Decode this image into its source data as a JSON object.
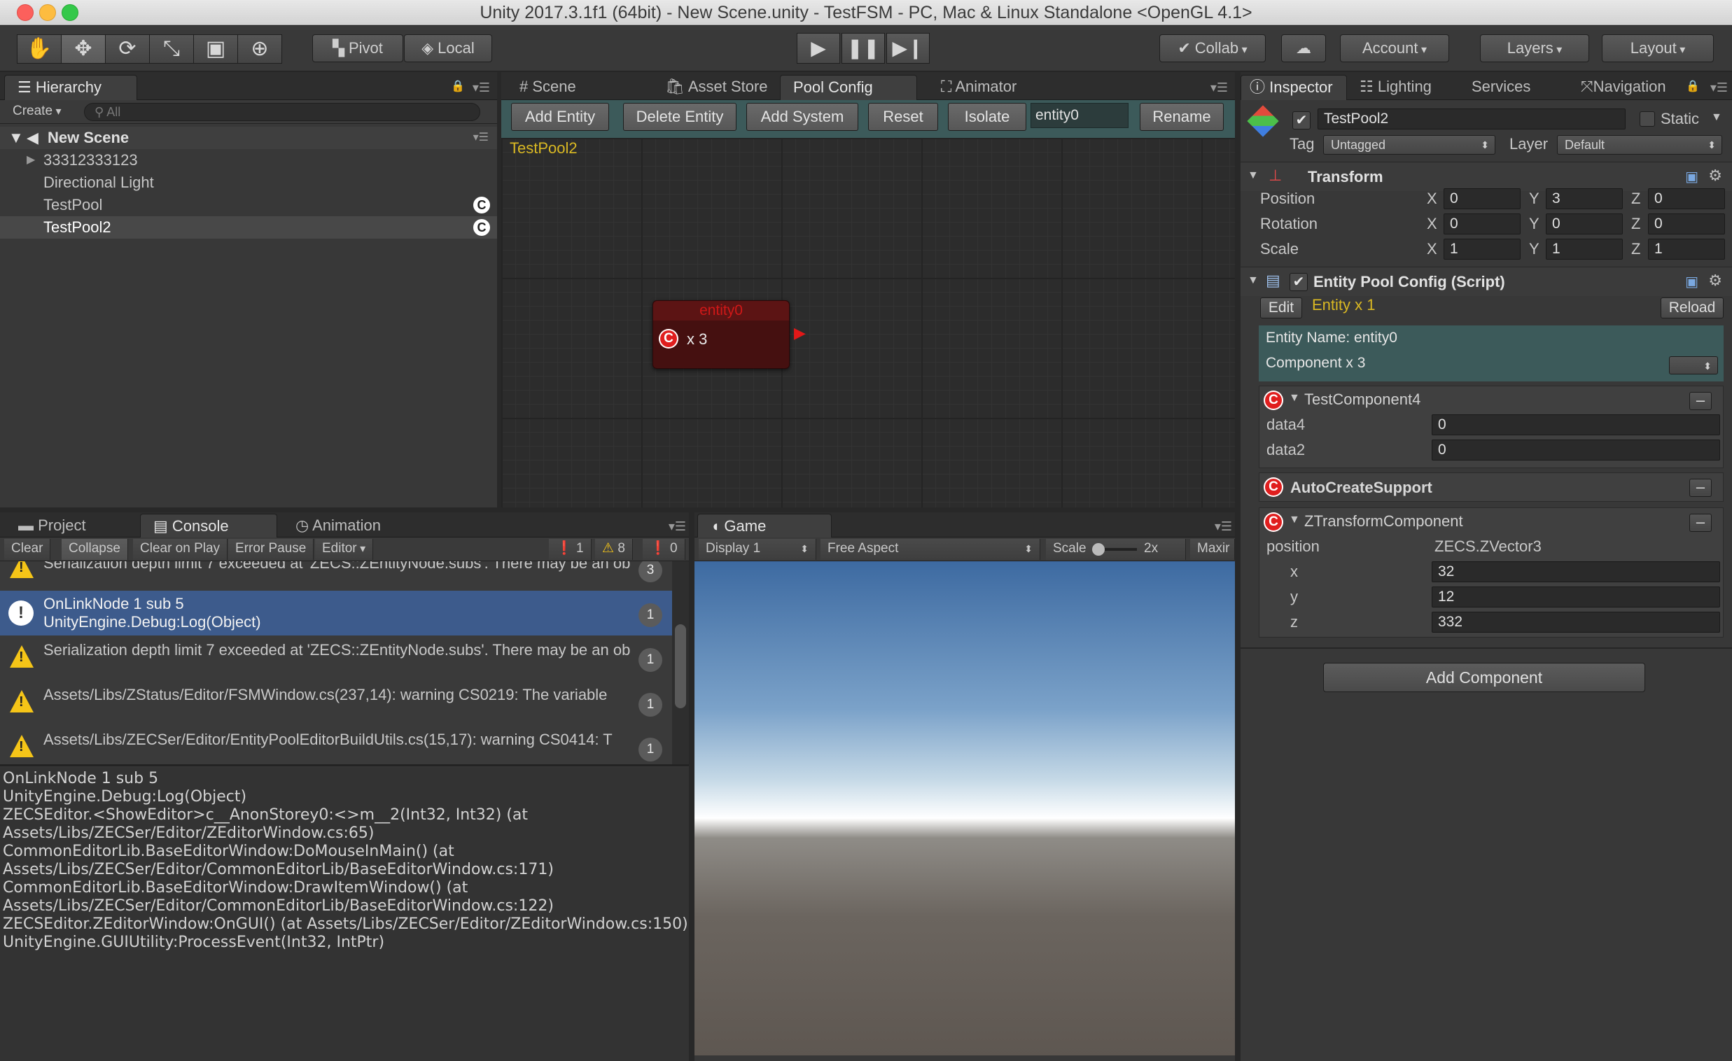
{
  "window": {
    "title": "Unity 2017.3.1f1 (64bit) - New Scene.unity - TestFSM - PC, Mac & Linux Standalone <OpenGL 4.1>"
  },
  "toolbar": {
    "pivot": "Pivot",
    "local": "Local",
    "collab": "Collab",
    "account": "Account",
    "layers": "Layers",
    "layout": "Layout"
  },
  "hierarchy": {
    "tab": "Hierarchy",
    "create": "Create",
    "search_placeholder": "All",
    "scene": "New Scene",
    "items": [
      {
        "label": "33312333123",
        "badge": ""
      },
      {
        "label": "Directional Light",
        "badge": ""
      },
      {
        "label": "TestPool",
        "badge": "C"
      },
      {
        "label": "TestPool2",
        "badge": "C"
      }
    ]
  },
  "center_tabs": {
    "scene": "Scene",
    "asset_store": "Asset Store",
    "pool_config": "Pool Config",
    "animator": "Animator"
  },
  "pool_config": {
    "buttons": {
      "add_entity": "Add Entity",
      "delete_entity": "Delete Entity",
      "add_system": "Add System",
      "reset": "Reset",
      "isolate": "Isolate",
      "rename": "Rename"
    },
    "name_field": "entity0",
    "pool_label": "TestPool2",
    "node": {
      "title": "entity0",
      "badge": "C",
      "count": "x 3"
    }
  },
  "bottom_tabs": {
    "project": "Project",
    "console": "Console",
    "animation": "Animation",
    "game": "Game"
  },
  "console": {
    "toolbar": {
      "clear": "Clear",
      "collapse": "Collapse",
      "clear_on_play": "Clear on Play",
      "error_pause": "Error Pause",
      "editor": "Editor"
    },
    "counts": {
      "info": "1",
      "warn": "8",
      "error": "0"
    },
    "rows": [
      {
        "line1": "Serialization depth limit 7 exceeded at 'ZECS::ZEntityNode.subs'. There may be an ob",
        "line2": "",
        "count": "3",
        "kind": "warn"
      },
      {
        "line1": "OnLinkNode 1 sub 5",
        "line2": "UnityEngine.Debug:Log(Object)",
        "count": "1",
        "kind": "info"
      },
      {
        "line1": "Serialization depth limit 7 exceeded at 'ZECS::ZEntityNode.subs'. There may be an ob",
        "line2": "",
        "count": "1",
        "kind": "warn"
      },
      {
        "line1": "Assets/Libs/ZStatus/Editor/FSMWindow.cs(237,14): warning CS0219: The variable",
        "line2": "",
        "count": "1",
        "kind": "warn"
      },
      {
        "line1": "Assets/Libs/ZECSer/Editor/EntityPoolEditorBuildUtils.cs(15,17): warning CS0414: T",
        "line2": "",
        "count": "1",
        "kind": "warn"
      }
    ],
    "trace": "OnLinkNode 1 sub 5\nUnityEngine.Debug:Log(Object)\nZECSEditor.<ShowEditor>c__AnonStorey0:<>m__2(Int32, Int32) (at\nAssets/Libs/ZECSer/Editor/ZEditorWindow.cs:65)\nCommonEditorLib.BaseEditorWindow:DoMouseInMain() (at\nAssets/Libs/ZECSer/Editor/CommonEditorLib/BaseEditorWindow.cs:171)\nCommonEditorLib.BaseEditorWindow:DrawItemWindow() (at\nAssets/Libs/ZECSer/Editor/CommonEditorLib/BaseEditorWindow.cs:122)\nZECSEditor.ZEditorWindow:OnGUI() (at Assets/Libs/ZECSer/Editor/ZEditorWindow.cs:150)\nUnityEngine.GUIUtility:ProcessEvent(Int32, IntPtr)"
  },
  "game": {
    "display": "Display 1",
    "aspect": "Free Aspect",
    "scale_label": "Scale",
    "scale_value": "2x",
    "maximize": "Maxir"
  },
  "inspector": {
    "tabs": {
      "inspector": "Inspector",
      "lighting": "Lighting",
      "services": "Services",
      "navigation": "Navigation"
    },
    "object_name": "TestPool2",
    "static_label": "Static",
    "tag_label": "Tag",
    "tag_value": "Untagged",
    "layer_label": "Layer",
    "layer_value": "Default",
    "transform": {
      "title": "Transform",
      "rows": [
        {
          "label": "Position",
          "x": "0",
          "y": "3",
          "z": "0"
        },
        {
          "label": "Rotation",
          "x": "0",
          "y": "0",
          "z": "0"
        },
        {
          "label": "Scale",
          "x": "1",
          "y": "1",
          "z": "1"
        }
      ],
      "axes": {
        "x": "X",
        "y": "Y",
        "z": "Z"
      }
    },
    "script": {
      "title": "Entity Pool Config (Script)",
      "edit": "Edit",
      "entity_count": "Entity x 1",
      "reload": "Reload",
      "entity_name": "Entity Name: entity0",
      "component_count": "Component x 3"
    },
    "components": {
      "c1": {
        "name": "TestComponent4",
        "data4_label": "data4",
        "data4": "0",
        "data2_label": "data2",
        "data2": "0"
      },
      "c2": {
        "name": "AutoCreateSupport"
      },
      "c3": {
        "name": "ZTransformComponent",
        "position_label": "position",
        "position_type": "ZECS.ZVector3",
        "x_label": "x",
        "x": "32",
        "y_label": "y",
        "y": "12",
        "z_label": "z",
        "z": "332"
      }
    },
    "add_component": "Add Component"
  }
}
